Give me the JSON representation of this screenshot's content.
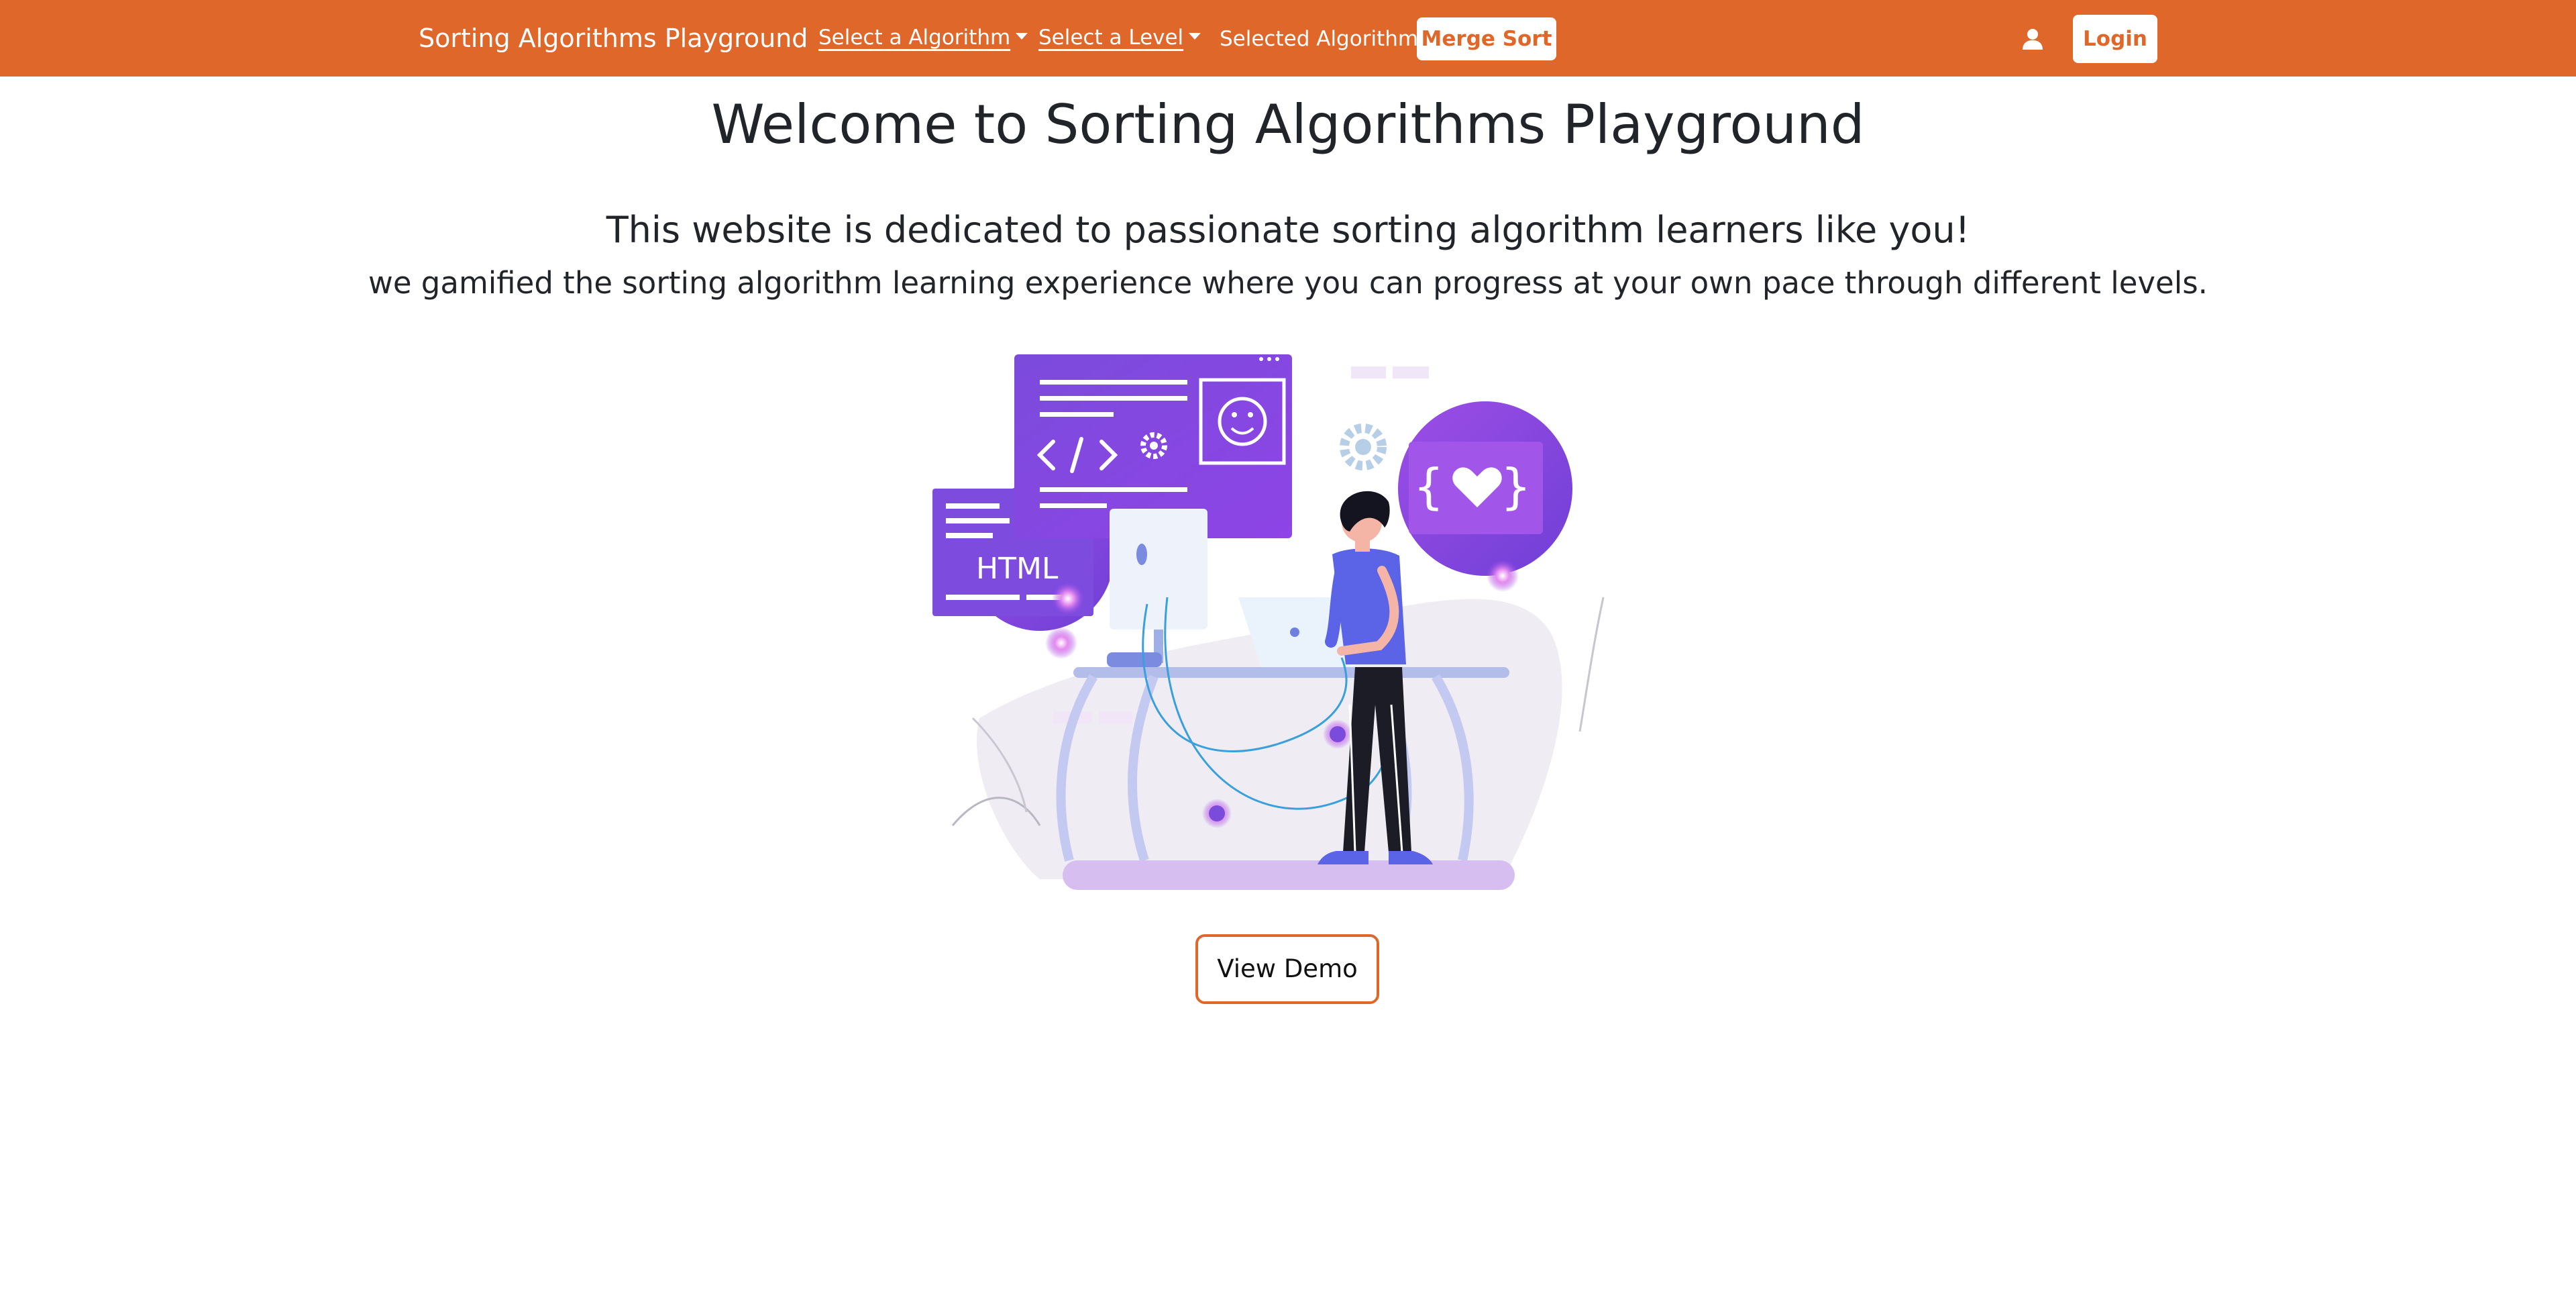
{
  "navbar": {
    "brand": "Sorting Algorithms Playground",
    "algorithm_dropdown_label": "Select a Algorithm",
    "level_dropdown_label": "Select a Level",
    "selected_label": "Selected Algorithm:",
    "selected_algorithm": "Merge Sort",
    "user_icon": "user-icon",
    "login_label": "Login",
    "bg_color": "#e0672a"
  },
  "main": {
    "title": "Welcome to Sorting Algorithms Playground",
    "subtitle": "This website is dedicated to passionate sorting algorithm learners like you!",
    "description": "we gamified the sorting algorithm learning experience where you can progress at your own pace through different levels.",
    "illustration_text": "HTML",
    "demo_button_label": "View Demo"
  }
}
